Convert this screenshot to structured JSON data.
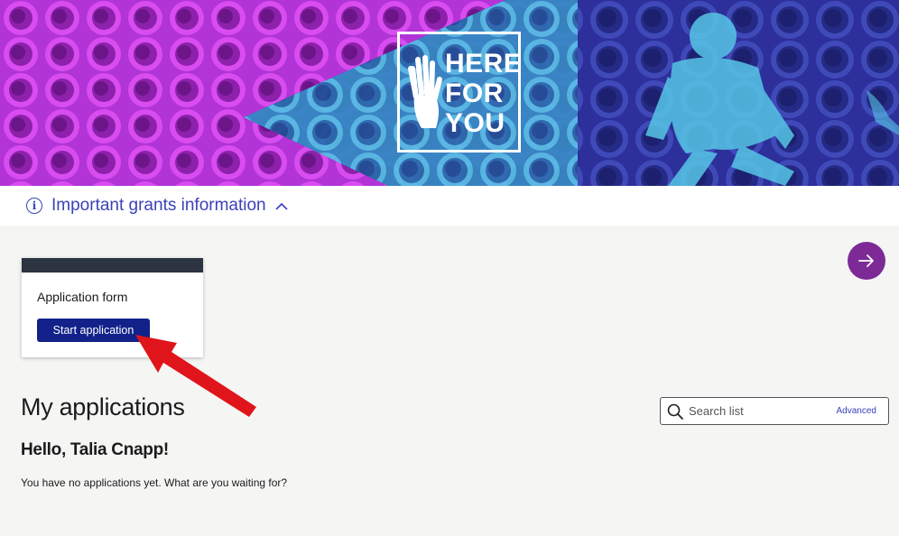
{
  "banner": {
    "logo_lines": [
      "HERE",
      "FOR",
      "YOU"
    ]
  },
  "info_bar": {
    "text": "Important grants information",
    "icon": "info-icon",
    "toggle_icon": "chevron-up-icon"
  },
  "card": {
    "title": "Application form",
    "button_label": "Start application"
  },
  "next_button": {
    "icon": "arrow-right-icon"
  },
  "applications": {
    "heading": "My applications",
    "greeting": "Hello, Talia Cnapp!",
    "empty_message": "You have no applications yet. What are you waiting for?"
  },
  "search": {
    "placeholder": "Search list",
    "value": "",
    "advanced_label": "Advanced"
  },
  "colors": {
    "accent": "#3a43b8",
    "button": "#12228a",
    "next_button": "#7d2a96",
    "card_header": "#2b3440",
    "annotation": "#e0141b"
  }
}
